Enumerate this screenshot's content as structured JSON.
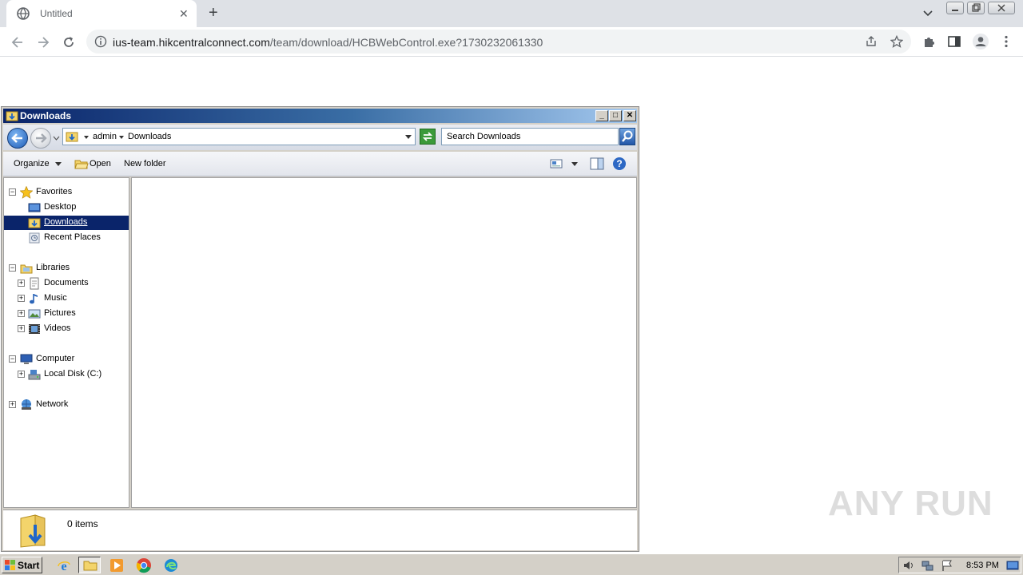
{
  "browser": {
    "tab_title": "Untitled",
    "tab_close": "✕",
    "new_tab": "+",
    "url_host": "ius-team.hikcentralconnect.com",
    "url_path": "/team/download/HCBWebControl.exe?1730232061330"
  },
  "explorer": {
    "title": "Downloads",
    "buttons": {
      "minimize": "_",
      "maximize": "□",
      "close": "✕"
    },
    "breadcrumb": [
      "admin",
      "Downloads"
    ],
    "search_placeholder": "Search Downloads",
    "commands": {
      "organize": "Organize",
      "open": "Open",
      "new_folder": "New folder"
    },
    "tree": {
      "favorites": "Favorites",
      "desktop": "Desktop",
      "downloads": "Downloads",
      "recent_places": "Recent Places",
      "libraries": "Libraries",
      "documents": "Documents",
      "music": "Music",
      "pictures": "Pictures",
      "videos": "Videos",
      "computer": "Computer",
      "local_disk": "Local Disk (C:)",
      "network": "Network"
    },
    "status": "0 items"
  },
  "watermark": "ANY RUN",
  "taskbar": {
    "start": "Start",
    "clock": "8:53 PM"
  },
  "colors": {
    "selection": "#0a246a",
    "chrome_tabstrip": "#dee1e6"
  }
}
